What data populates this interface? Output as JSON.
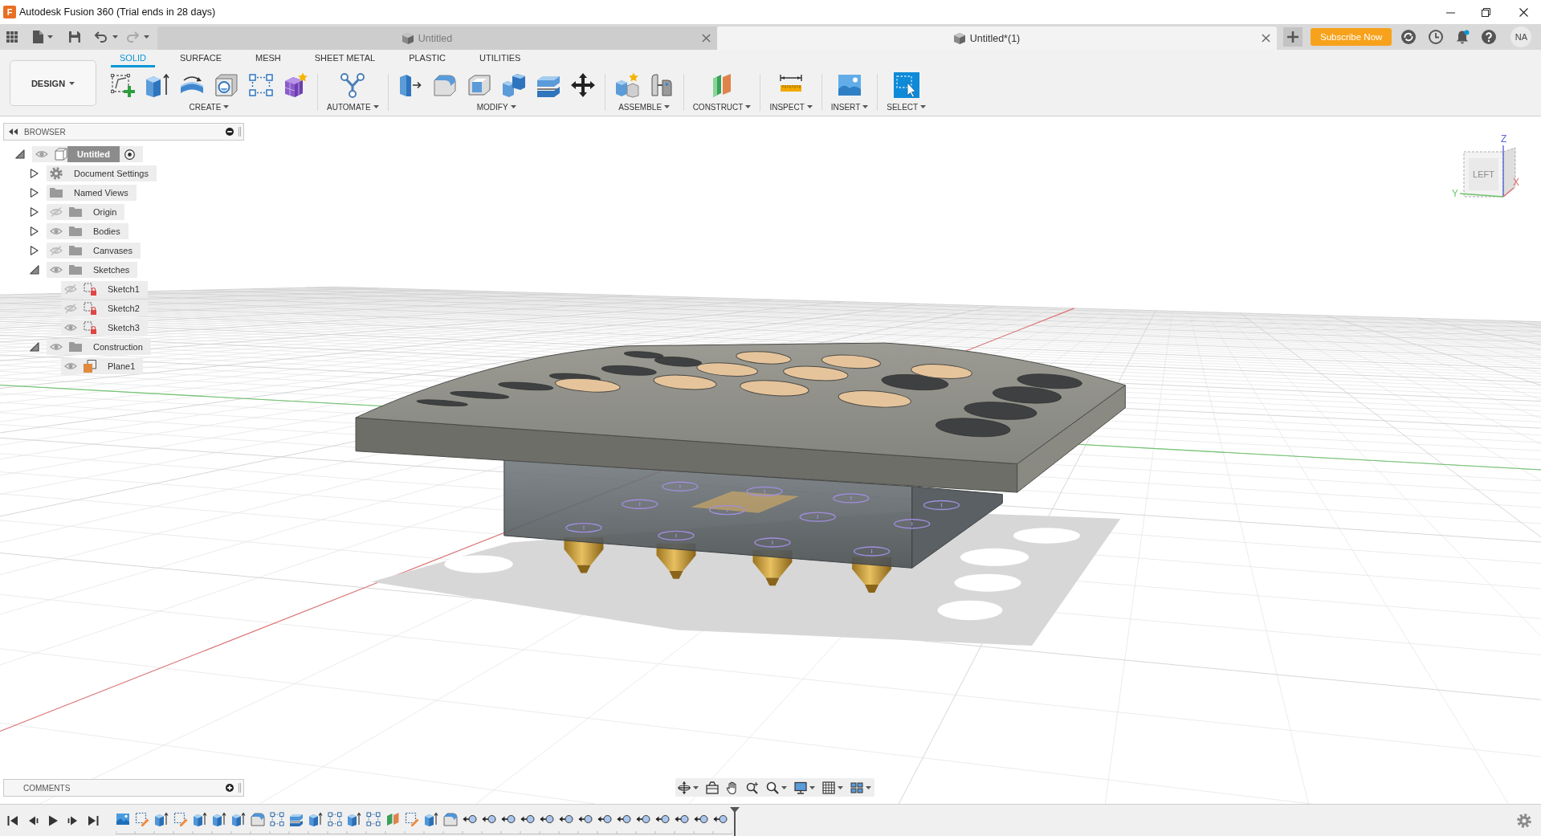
{
  "window": {
    "logo": "F",
    "title": "Autodesk Fusion 360 (Trial ends in 28 days)"
  },
  "quick_access": {
    "undo": {
      "disabled": false
    },
    "redo": {
      "disabled": true
    }
  },
  "document_tabs": [
    {
      "title": "Untitled",
      "selected": false
    },
    {
      "title": "Untitled*(1)",
      "selected": true
    }
  ],
  "account": {
    "subscribe_button": "Subscribe Now",
    "avatar_initials": "NA"
  },
  "workspace_menu": "DESIGN",
  "toolbar_tabs": [
    {
      "label": "SOLID",
      "selected": true
    },
    {
      "label": "SURFACE",
      "selected": false
    },
    {
      "label": "MESH",
      "selected": false
    },
    {
      "label": "SHEET METAL",
      "selected": false
    },
    {
      "label": "PLASTIC",
      "selected": false
    },
    {
      "label": "UTILITIES",
      "selected": false
    }
  ],
  "toolbar_groups": [
    {
      "kind": "create",
      "label": "CREATE"
    },
    {
      "kind": "automate",
      "label": "AUTOMATE"
    },
    {
      "kind": "modify",
      "label": "MODIFY"
    },
    {
      "kind": "assemble",
      "label": "ASSEMBLE"
    },
    {
      "kind": "construct",
      "label": "CONSTRUCT"
    },
    {
      "kind": "inspect",
      "label": "INSPECT"
    },
    {
      "kind": "insert",
      "label": "INSERT"
    },
    {
      "kind": "select",
      "label": "SELECT"
    }
  ],
  "browser": {
    "title": "BROWSER",
    "root": {
      "label": "Untitled",
      "kind": "component",
      "expanded": true,
      "visible": true,
      "active": true,
      "children": [
        {
          "label": "Document Settings",
          "kind": "settings",
          "expanded": false
        },
        {
          "label": "Named Views",
          "kind": "folder",
          "expanded": false
        },
        {
          "label": "Origin",
          "kind": "folder",
          "expanded": false,
          "visible": false
        },
        {
          "label": "Bodies",
          "kind": "folder",
          "expanded": false,
          "visible": true
        },
        {
          "label": "Canvases",
          "kind": "folder",
          "expanded": false,
          "visible": false
        },
        {
          "label": "Sketches",
          "kind": "folder",
          "expanded": true,
          "visible": true,
          "children": [
            {
              "label": "Sketch1",
              "kind": "sketch",
              "visible": false
            },
            {
              "label": "Sketch2",
              "kind": "sketch",
              "visible": false
            },
            {
              "label": "Sketch3",
              "kind": "sketch",
              "visible": true
            }
          ]
        },
        {
          "label": "Construction",
          "kind": "folder",
          "expanded": true,
          "visible": true,
          "children": [
            {
              "label": "Plane1",
              "kind": "plane",
              "visible": true
            }
          ]
        }
      ]
    }
  },
  "view_cube": {
    "face_label": "LEFT",
    "axis_labels": [
      "Z",
      "Y",
      "X"
    ]
  },
  "comments": {
    "title": "COMMENTS"
  }
}
